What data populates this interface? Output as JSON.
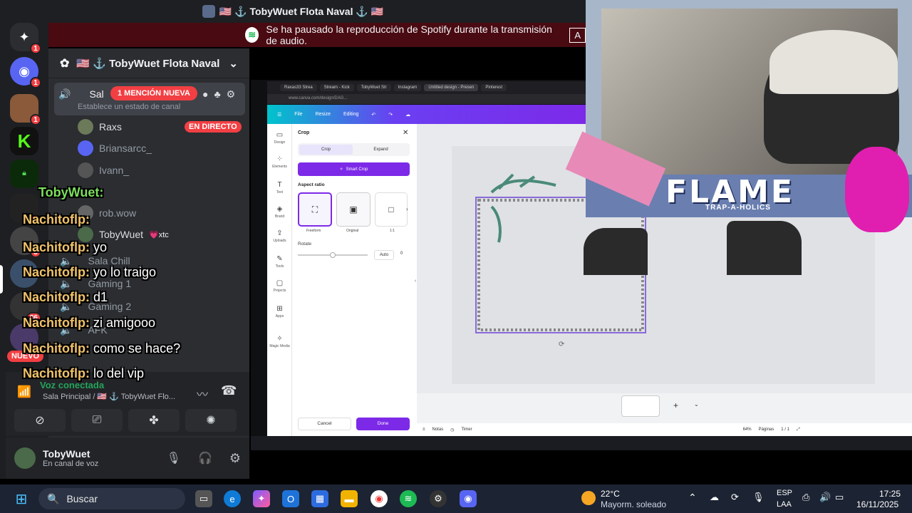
{
  "window": {
    "title": "🇺🇸 ⚓ TobyWuet Flota Naval ⚓ 🇺🇸"
  },
  "spotify_banner": {
    "text": "Se ha pausado la reproducción de Spotify durante la transmisión de audio.",
    "action": "A"
  },
  "server": {
    "name": "🇺🇸 ⚓ TobyWuet Flota Naval ...",
    "badges": [
      "1",
      "1",
      "1",
      "3",
      "3",
      "36",
      "4"
    ],
    "new_label": "NUEVO"
  },
  "voice_channel": {
    "name": "Sal",
    "mention_badge": "1 MENCIÓN NUEVA",
    "status_hint": "Establece un estado de canal",
    "members": [
      {
        "name": "Raxs",
        "live": "EN DIRECTO"
      },
      {
        "name": "Briansarcc_"
      },
      {
        "name": "Ivann_"
      },
      {
        "name": "rob.wow"
      },
      {
        "name": "TobyWuet",
        "tag": "💗xtc"
      }
    ],
    "other_channels": [
      "Sala Chill",
      "Gaming 1",
      "Gaming 2",
      "AFK"
    ]
  },
  "chat_overlay": [
    {
      "user": "TobyWuet:",
      "msg": ""
    },
    {
      "user": "Nachitoflp:",
      "msg": ""
    },
    {
      "user": "Nachitoflp:",
      "msg": "yo"
    },
    {
      "user": "Nachitoflp:",
      "msg": "yo lo traigo"
    },
    {
      "user": "Nachitoflp:",
      "msg": "d1"
    },
    {
      "user": "Nachitoflp:",
      "msg": "zi amigooo"
    },
    {
      "user": "Nachitoflp:",
      "msg": "como se hace?"
    },
    {
      "user": "Nachitoflp:",
      "msg": "lo del vip"
    }
  ],
  "voice_panel": {
    "status": "Voz conectada",
    "location": "Sala Principal / 🇺🇸 ⚓ TobyWuet Flo..."
  },
  "user_panel": {
    "name": "TobyWuet",
    "status": "En canal de voz"
  },
  "browser": {
    "tabs": [
      "Raxas33 Strea",
      "Stream - Kick",
      "TobyWuet Str",
      "Instagram",
      "Untitled design - Presen",
      "Pinterest"
    ],
    "url": "www.canva.com/design/DAG..."
  },
  "canva": {
    "menu": [
      "File",
      "Resize",
      "Editing"
    ],
    "left_nav": [
      "Design",
      "Elements",
      "Text",
      "Brand",
      "Uploads",
      "Tools",
      "Projects",
      "Apps",
      "Magic Media"
    ],
    "crop": {
      "title": "Crop",
      "tabs": [
        "Crop",
        "Expand"
      ],
      "smart_crop": "Smart Crop",
      "aspect_label": "Aspect ratio",
      "aspect_options": [
        "Freeform",
        "Original",
        "1:1"
      ],
      "rotate_label": "Rotate",
      "rotate_value": "Auto",
      "rotate_num": "0",
      "cancel": "Cancel",
      "done": "Done"
    },
    "footer": {
      "notes": "Notas",
      "timer": "Timer",
      "zoom": "64%",
      "pages": "Páginas",
      "page_count": "1 / 1"
    }
  },
  "webcam": {
    "overlay_title": "FLAME",
    "overlay_sub": "TRAP-A-HOLICS"
  },
  "taskbar": {
    "search": "Buscar",
    "weather_temp": "22°C",
    "weather_desc": "Mayorm. soleado",
    "lang": "ESP",
    "lang2": "LAA",
    "time": "17:25",
    "date": "16/11/2025"
  }
}
